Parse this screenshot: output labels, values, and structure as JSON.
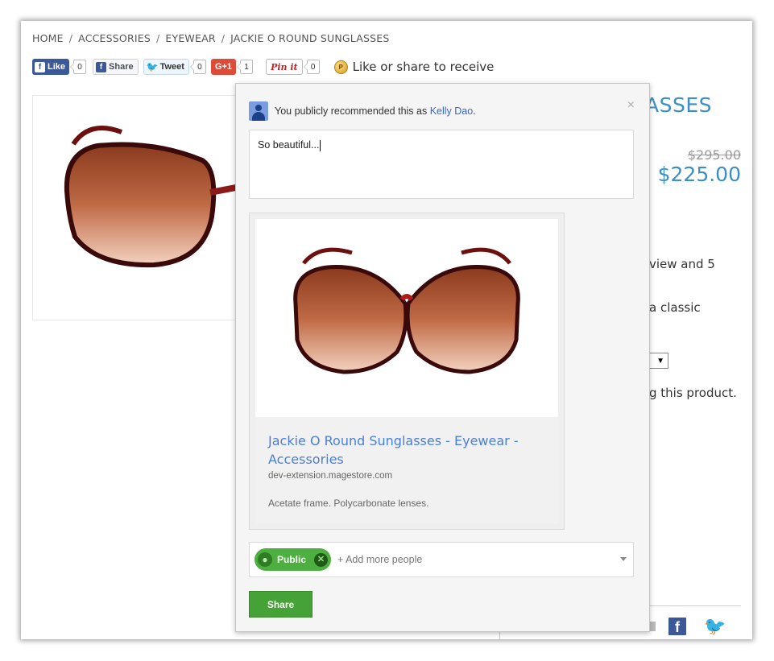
{
  "breadcrumb": [
    "HOME",
    "ACCESSORIES",
    "EYEWEAR",
    "JACKIE O ROUND SUNGLASSES"
  ],
  "breadcrumb_separator": "/",
  "social": {
    "fb_like_label": "Like",
    "fb_like_count": "0",
    "fb_share_label": "Share",
    "tweet_label": "Tweet",
    "tweet_count": "0",
    "gplus_label": "G+1",
    "gplus_count": "1",
    "pinit_label": "Pin it",
    "pinit_count": "0",
    "reward_text": "Like or share to receive"
  },
  "product": {
    "title_partial": "ASSES",
    "old_price": "$295.00",
    "new_price": "$225.00",
    "desc_line1": "view and 5",
    "desc_line2": "a classic",
    "select_arrow": "▼",
    "desc_line3": "g this product."
  },
  "gplus_popup": {
    "recommended_prefix": "You publicly recommended this as",
    "user_name": "Kelly Dao",
    "recommended_suffix": ".",
    "close": "×",
    "comment_text": "So beautiful...",
    "card_title": "Jackie O Round Sunglasses - Eyewear - Accessories",
    "card_domain": "dev-extension.magestore.com",
    "card_description": "Acetate frame. Polycarbonate lenses.",
    "audience_chip": "Public",
    "add_people_placeholder": "+ Add more people",
    "share_button": "Share"
  },
  "colors": {
    "accent_blue": "#3a8fc8",
    "gplus_red": "#dd4b39",
    "share_green": "#45a236",
    "facebook_blue": "#3b5998",
    "twitter_blue": "#2aa3ef"
  },
  "icons": [
    "facebook-icon",
    "twitter-icon",
    "gplus-icon",
    "pinterest-icon",
    "coin-icon",
    "avatar-icon",
    "close-icon",
    "globe-icon",
    "remove-chip-icon",
    "chevron-down-icon",
    "mail-icon"
  ]
}
